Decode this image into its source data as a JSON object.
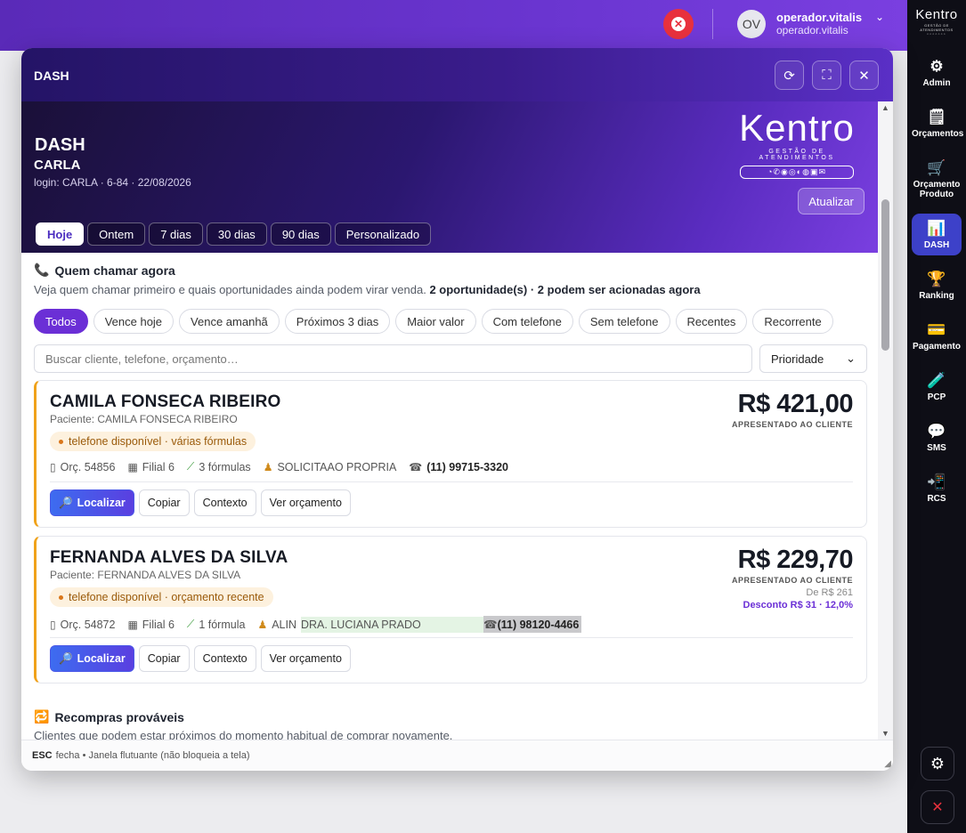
{
  "topbar": {
    "user_name": "operador.vitalis",
    "user_sub": "operador.vitalis",
    "avatar_initials": "OV",
    "close_icon": "close-circle-icon",
    "accent": "#6a35d0"
  },
  "rail": {
    "logo": "Kentro",
    "logo_sub": "GESTÃO DE ATENDIMENTOS",
    "items": [
      {
        "label": "Admin",
        "icon": "⚙"
      },
      {
        "label": "Orçamentos",
        "icon": "🗒"
      },
      {
        "label": "Orçamento Produto",
        "icon": "🛒"
      },
      {
        "label": "DASH",
        "icon": "📊"
      },
      {
        "label": "Ranking",
        "icon": "🏆"
      },
      {
        "label": "Pagamento",
        "icon": "💳"
      },
      {
        "label": "PCP",
        "icon": "🧪"
      },
      {
        "label": "SMS",
        "icon": "💬"
      },
      {
        "label": "RCS",
        "icon": "📲"
      }
    ],
    "active_item": "DASH",
    "active_color": "#3d41c9"
  },
  "modal": {
    "title": "DASH",
    "hero": {
      "title": "DASH",
      "subtitle": "CARLA",
      "login_line": "login: CARLA · 6-84 · 22/08/2026",
      "brand": "Kentro",
      "brand_sub": "GESTÃO DE ATENDIMENTOS",
      "refresh_label": "Atualizar"
    },
    "periods": [
      "Hoje",
      "Ontem",
      "7 dias",
      "30 dias",
      "90 dias",
      "Personalizado"
    ],
    "active_period": "Hoje",
    "quem_chamar": {
      "title": "Quem chamar agora",
      "subtitle_start": "Veja quem chamar primeiro e quais oportunidades ainda podem virar venda.",
      "subtitle_bold": "2 oportunidade(s) · 2 podem ser acionadas agora",
      "filters": [
        "Todos",
        "Vence hoje",
        "Vence amanhã",
        "Próximos 3 dias",
        "Maior valor",
        "Com telefone",
        "Sem telefone",
        "Recentes",
        "Recorrente"
      ],
      "search_placeholder": "Buscar cliente, telefone, orçamento…",
      "sort_value": "Prioridade"
    },
    "cards": [
      {
        "name": "CAMILA FONSECA RIBEIRO",
        "patient": "Paciente: CAMILA FONSECA RIBEIRO",
        "tag": "telefone disponível · várias fórmulas",
        "orc": "Orç. 54856",
        "filial": "Filial 6",
        "formulas": "3 fórmulas",
        "prescriber": "SOLICITAAO PROPRIA",
        "phone": "(11) 99715-3320",
        "price": "R$ 421,00",
        "price_label": "APRESENTADO AO CLIENTE"
      },
      {
        "name": "FERNANDA ALVES DA SILVA",
        "patient": "Paciente: FERNANDA ALVES DA SILVA",
        "tag": "telefone disponível · orçamento recente",
        "orc": "Orç. 54872",
        "filial": "Filial 6",
        "formulas": "1 fórmula",
        "prescriber": "ALIN",
        "prescriber_hl": "DRA. LUCIANA PRADO",
        "phone": "(11) 98120-4466",
        "price": "R$ 229,70",
        "price_label": "APRESENTADO AO CLIENTE",
        "price_from": "De R$ 261",
        "discount": "Desconto R$ 31 · 12,0%"
      }
    ],
    "actions": {
      "locate": "Localizar",
      "copy": "Copiar",
      "context": "Contexto",
      "view": "Ver orçamento"
    },
    "recompras": {
      "title": "Recompras prováveis",
      "subtitle": "Clientes que podem estar próximos do momento habitual de comprar novamente."
    },
    "footer": {
      "key": "ESC",
      "text": "fecha • Janela flutuante (não bloqueia a tela)"
    }
  }
}
